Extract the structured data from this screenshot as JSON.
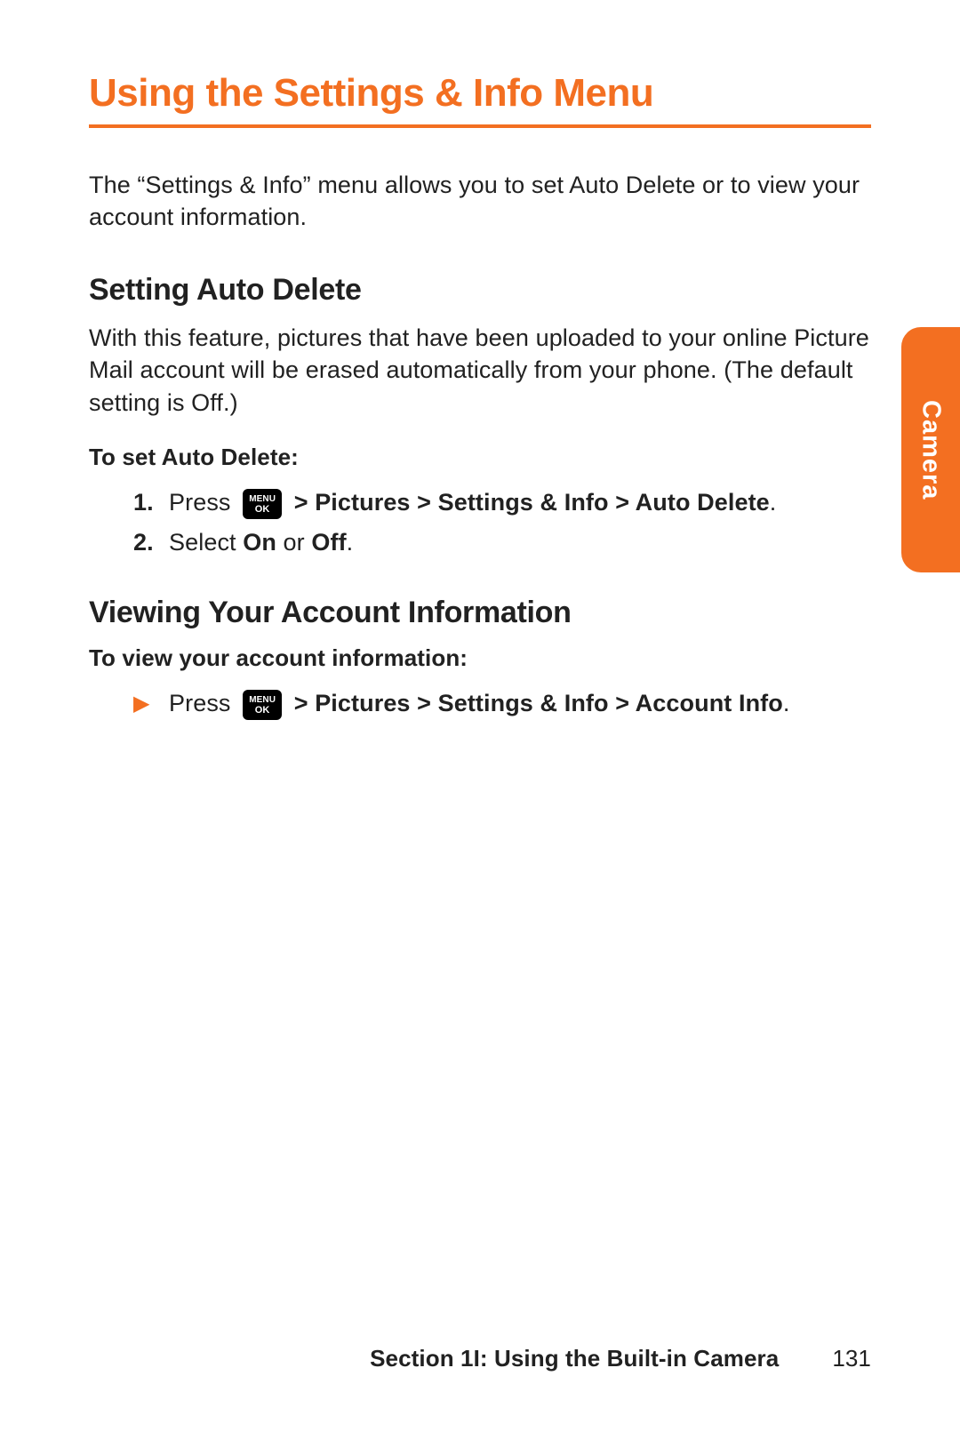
{
  "title": "Using the Settings & Info Menu",
  "intro": "The “Settings & Info” menu allows you to set Auto Delete or to view your account information.",
  "section1": {
    "heading": "Setting Auto Delete",
    "body": "With this feature, pictures that have been uploaded to your online Picture Mail account will be erased automatically from your phone. (The default setting is Off.)",
    "label": "To set Auto Delete:",
    "steps": [
      {
        "num": "1.",
        "pre": "Press ",
        "key_l1": "MENU",
        "key_l2": "OK",
        "path": " > Pictures > Settings & Info > Auto Delete",
        "suffix": "."
      },
      {
        "num": "2.",
        "pre": "Select ",
        "bold1": "On",
        "mid": " or ",
        "bold2": "Off",
        "suffix2": "."
      }
    ]
  },
  "section2": {
    "heading": "Viewing Your Account Information",
    "label": "To view your account information:",
    "step": {
      "arrow": "▶",
      "pre": "Press ",
      "key_l1": "MENU",
      "key_l2": "OK",
      "path": " > Pictures > Settings & Info > Account Info",
      "suffix": "."
    }
  },
  "sidetab": "Camera",
  "footer": {
    "section": "Section 1I: Using the Built-in Camera",
    "page": "131"
  }
}
